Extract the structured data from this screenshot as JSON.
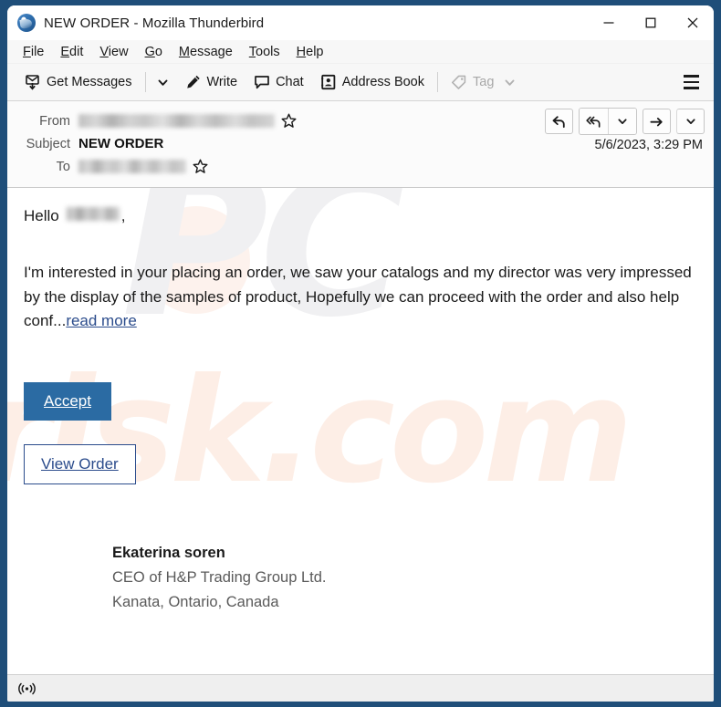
{
  "window": {
    "title": "NEW ORDER - Mozilla Thunderbird",
    "app_icon": "thunderbird-icon",
    "minimize_label": "Minimize",
    "maximize_label": "Maximize",
    "close_label": "Close"
  },
  "menubar": {
    "items": [
      {
        "label": "File",
        "accesskey": "F"
      },
      {
        "label": "Edit",
        "accesskey": "E"
      },
      {
        "label": "View",
        "accesskey": "V"
      },
      {
        "label": "Go",
        "accesskey": "G"
      },
      {
        "label": "Message",
        "accesskey": "M"
      },
      {
        "label": "Tools",
        "accesskey": "T"
      },
      {
        "label": "Help",
        "accesskey": "H"
      }
    ]
  },
  "toolbar": {
    "get_messages_label": "Get Messages",
    "get_messages_icon": "download-mail-icon",
    "get_messages_caret_icon": "chevron-down-icon",
    "write_label": "Write",
    "write_icon": "pencil-icon",
    "chat_label": "Chat",
    "chat_icon": "chat-bubble-icon",
    "address_book_label": "Address Book",
    "address_book_icon": "address-book-icon",
    "tag_label": "Tag",
    "tag_icon": "tag-icon",
    "tag_caret_icon": "chevron-down-icon",
    "tag_disabled": true,
    "app_menu_icon": "hamburger-menu-icon"
  },
  "message_header": {
    "from_label": "From",
    "from_value": "",
    "from_redacted": true,
    "from_star_icon": "star-outline-icon",
    "subject_label": "Subject",
    "subject_value": "NEW ORDER",
    "to_label": "To",
    "to_value": "",
    "to_redacted": true,
    "to_star_icon": "star-outline-icon",
    "date": "5/6/2023, 3:29 PM",
    "actions": [
      {
        "name": "reply-button",
        "icon": "reply-arrow-icon"
      },
      {
        "name": "reply-all-button",
        "icon": "reply-all-arrow-icon"
      },
      {
        "name": "reply-all-dropdown-button",
        "icon": "chevron-down-icon"
      },
      {
        "name": "forward-button",
        "icon": "forward-arrow-icon"
      },
      {
        "name": "more-actions-dropdown-button",
        "icon": "chevron-down-icon"
      }
    ]
  },
  "message_body": {
    "greeting_prefix": "Hello",
    "greeting_name_redacted": true,
    "greeting_suffix": ",",
    "paragraph": "I'm interested in your placing an order, we saw your catalogs and my director was very impressed by the display of the samples of product, Hopefully we can proceed with the order and also help conf...",
    "read_more_label": "read more",
    "accept_button_label": "Accept",
    "view_order_button_label": "View Order",
    "signature": {
      "name": "Ekaterina soren",
      "title": "CEO of H&P Trading Group Ltd.",
      "location": "Kanata, Ontario, Canada"
    },
    "watermark_primary": "PC",
    "watermark_secondary": "risk.com"
  },
  "statusbar": {
    "rss_icon": "rss-broadcast-icon",
    "text": ""
  },
  "colors": {
    "desktop": "#1f4e79",
    "accept_button": "#2b6ba3",
    "link": "#2b4c8c",
    "toolbar_bg": "#f7f7f7",
    "header_bg": "#fbfbfb",
    "statusbar_bg": "#efefef",
    "watermark_pc": "#f0f0f2",
    "watermark_risk": "#fdeee6"
  }
}
